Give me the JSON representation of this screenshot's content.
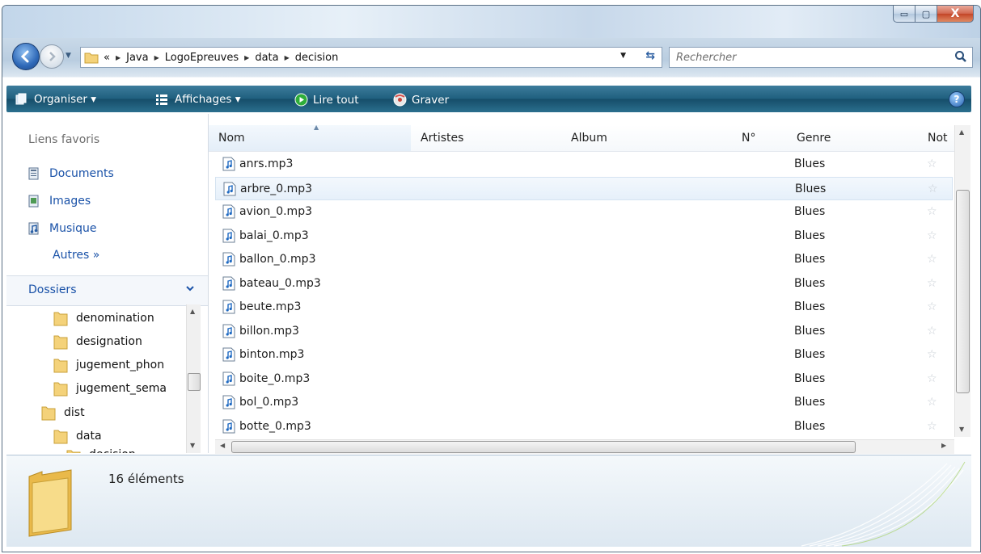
{
  "window": {
    "caption_buttons": {
      "minimize": "▭",
      "maximize": "▢",
      "close": "X"
    }
  },
  "address": {
    "prefix": "«",
    "crumbs": [
      "Java",
      "LogoEpreuves",
      "data",
      "decision"
    ]
  },
  "search": {
    "placeholder": "Rechercher"
  },
  "commandbar": {
    "organiser": "Organiser ▾",
    "affichages": "Affichages ▾",
    "lire_tout": "Lire tout",
    "graver": "Graver",
    "help": "?"
  },
  "favorites": {
    "title": "Liens favoris",
    "items": [
      {
        "label": "Documents",
        "icon": "documents-icon"
      },
      {
        "label": "Images",
        "icon": "images-icon"
      },
      {
        "label": "Musique",
        "icon": "music-icon"
      }
    ],
    "more": "Autres »"
  },
  "folders": {
    "title": "Dossiers",
    "tree": [
      {
        "label": "denomination",
        "level": 2
      },
      {
        "label": "designation",
        "level": 2
      },
      {
        "label": "jugement_phon",
        "level": 2
      },
      {
        "label": "jugement_sema",
        "level": 2
      },
      {
        "label": "dist",
        "level": 1
      },
      {
        "label": "data",
        "level": 2
      },
      {
        "label": "decision",
        "level": 3
      }
    ]
  },
  "columns": [
    "Nom",
    "Artistes",
    "Album",
    "N°",
    "Genre",
    "Not"
  ],
  "files": [
    {
      "name": "anrs.mp3",
      "genre": "Blues"
    },
    {
      "name": "arbre_0.mp3",
      "genre": "Blues",
      "selected": true
    },
    {
      "name": "avion_0.mp3",
      "genre": "Blues"
    },
    {
      "name": "balai_0.mp3",
      "genre": "Blues"
    },
    {
      "name": "ballon_0.mp3",
      "genre": "Blues"
    },
    {
      "name": "bateau_0.mp3",
      "genre": "Blues"
    },
    {
      "name": "beute.mp3",
      "genre": "Blues"
    },
    {
      "name": "billon.mp3",
      "genre": "Blues"
    },
    {
      "name": "binton.mp3",
      "genre": "Blues"
    },
    {
      "name": "boite_0.mp3",
      "genre": "Blues"
    },
    {
      "name": "bol_0.mp3",
      "genre": "Blues"
    },
    {
      "name": "botte_0.mp3",
      "genre": "Blues"
    }
  ],
  "status": {
    "count": "16 éléments"
  },
  "colors": {
    "commandbar": "#20607f",
    "link": "#1a52a8",
    "accent": "#2f69b8"
  }
}
